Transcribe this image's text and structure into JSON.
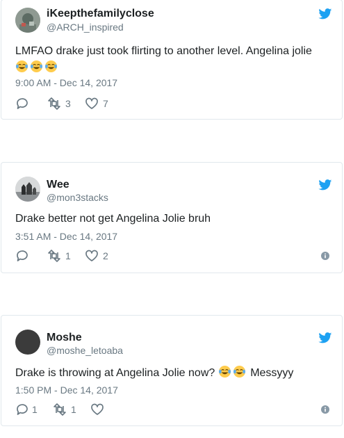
{
  "tweets": [
    {
      "name": "iKeepthefamilyclose",
      "handle": "@ARCH_inspired",
      "text_before": "LMFAO drake just took flirting to another level. Angelina jolie",
      "emoji_count": 3,
      "time": "9:00 AM - Dec 14, 2017",
      "reply_count": "",
      "retweet_count": "3",
      "like_count": "7"
    },
    {
      "name": "Wee",
      "handle": "@mon3stacks",
      "text_before": "Drake better not get Angelina Jolie bruh",
      "time": "3:51 AM - Dec 14, 2017",
      "reply_count": "",
      "retweet_count": "1",
      "like_count": "2"
    },
    {
      "name": "Moshe",
      "handle": "@moshe_letoaba",
      "text_before": "Drake is throwing at Angelina Jolie now?",
      "text_after": "Messyyy",
      "emoji_count": 2,
      "time": "1:50 PM - Dec 14, 2017",
      "reply_count": "1",
      "retweet_count": "1",
      "like_count": ""
    }
  ],
  "icons": {
    "brand": "twitter-bird-icon",
    "reply": "reply-icon",
    "retweet": "retweet-icon",
    "like": "heart-icon",
    "info": "info-icon",
    "emoji": "face-with-tears-of-joy-emoji"
  },
  "colors": {
    "brand_blue": "#1da1f2",
    "text": "#1c2022",
    "muted": "#697882",
    "border": "#e1e8ed",
    "emoji_yellow": "#ffcc4d"
  }
}
